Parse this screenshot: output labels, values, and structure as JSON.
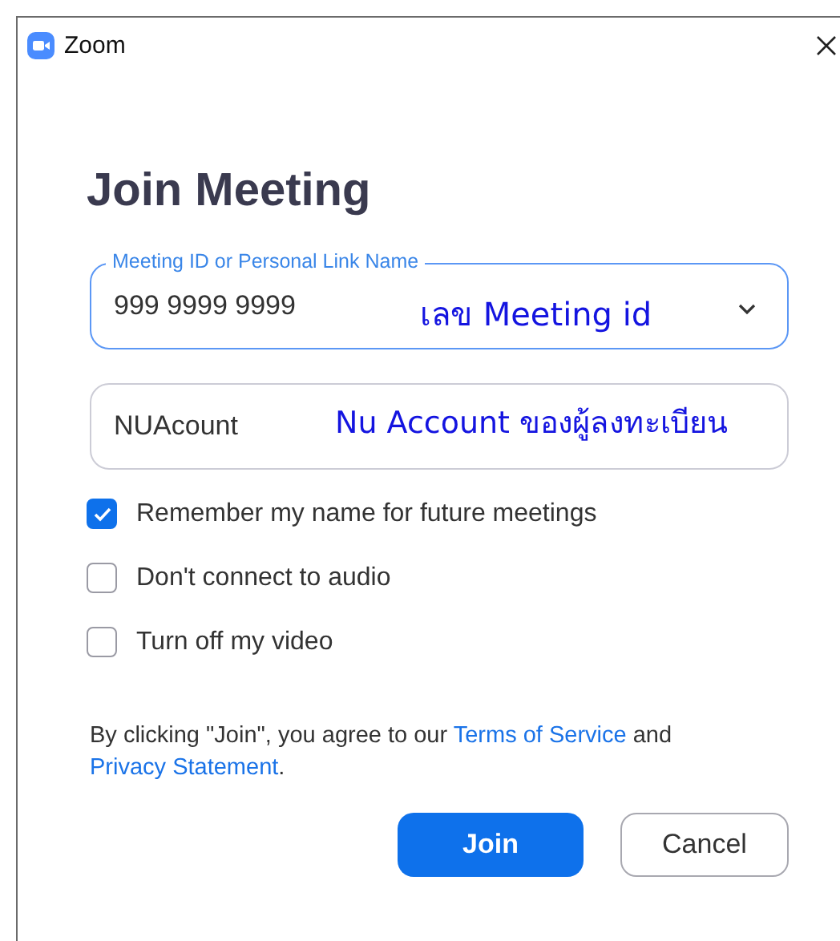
{
  "window": {
    "title": "Zoom"
  },
  "heading": "Join Meeting",
  "meeting_field": {
    "label": "Meeting ID or Personal Link Name",
    "value": "999 9999 9999",
    "annotation": "เลข Meeting id"
  },
  "name_field": {
    "value": "NUAcount",
    "annotation": "Nu Account ของผู้ลงทะเบียน"
  },
  "options": [
    {
      "label": "Remember my name for future meetings",
      "checked": true
    },
    {
      "label": "Don't connect to audio",
      "checked": false
    },
    {
      "label": "Turn off my video",
      "checked": false
    }
  ],
  "notice": {
    "before": "By clicking \"Join\", you agree to our ",
    "terms_link": "Terms of Service",
    "middle": " and",
    "privacy_link": "Privacy Statement",
    "after": "."
  },
  "buttons": [
    {
      "label": "Join",
      "kind": "primary"
    },
    {
      "label": "Cancel",
      "kind": "secondary"
    }
  ]
}
